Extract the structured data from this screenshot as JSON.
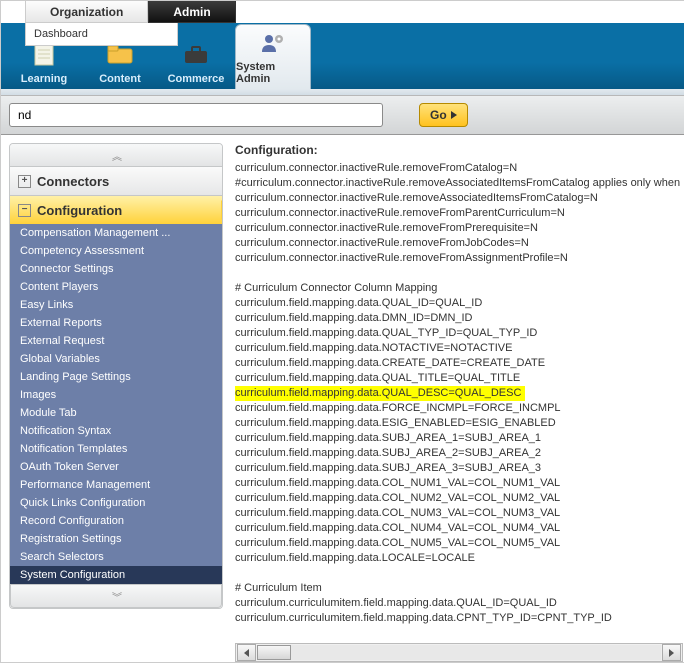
{
  "topmenu": {
    "org": "Organization",
    "admin": "Admin",
    "dropdown": "Dashboard"
  },
  "ribbon": {
    "tabs": [
      {
        "label": "Learning",
        "icon": "page-lines-icon"
      },
      {
        "label": "Content",
        "icon": "folder-icon"
      },
      {
        "label": "Commerce",
        "icon": "briefcase-icon"
      },
      {
        "label": "System Admin",
        "icon": "user-gear-icon"
      }
    ],
    "active_index": 3
  },
  "search": {
    "value": "nd",
    "go": "Go"
  },
  "sidebar": {
    "sections": {
      "connectors": "Connectors",
      "configuration": "Configuration"
    },
    "items": [
      "Compensation Management ...",
      "Competency Assessment",
      "Connector Settings",
      "Content Players",
      "Easy Links",
      "External Reports",
      "External Request",
      "Global Variables",
      "Landing Page Settings",
      "Images",
      "Module Tab",
      "Notification Syntax",
      "Notification Templates",
      "OAuth Token Server",
      "Performance Management",
      "Quick Links Configuration",
      "Record Configuration",
      "Registration Settings",
      "Search Selectors",
      "System Configuration"
    ],
    "active_index": 19
  },
  "content": {
    "title": "Configuration:",
    "lines": [
      "curriculum.connector.inactiveRule.removeFromCatalog=N",
      "#curriculum.connector.inactiveRule.removeAssociatedItemsFromCatalog applies only when",
      "curriculum.connector.inactiveRule.removeAssociatedItemsFromCatalog=N",
      "curriculum.connector.inactiveRule.removeFromParentCurriculum=N",
      "curriculum.connector.inactiveRule.removeFromPrerequisite=N",
      "curriculum.connector.inactiveRule.removeFromJobCodes=N",
      "curriculum.connector.inactiveRule.removeFromAssignmentProfile=N",
      "",
      "# Curriculum Connector Column Mapping",
      "curriculum.field.mapping.data.QUAL_ID=QUAL_ID",
      "curriculum.field.mapping.data.DMN_ID=DMN_ID",
      "curriculum.field.mapping.data.QUAL_TYP_ID=QUAL_TYP_ID",
      "curriculum.field.mapping.data.NOTACTIVE=NOTACTIVE",
      "curriculum.field.mapping.data.CREATE_DATE=CREATE_DATE",
      "curriculum.field.mapping.data.QUAL_TITLE=QUAL_TITLE",
      "curriculum.field.mapping.data.QUAL_DESC=QUAL_DESC",
      "curriculum.field.mapping.data.FORCE_INCMPL=FORCE_INCMPL",
      "curriculum.field.mapping.data.ESIG_ENABLED=ESIG_ENABLED",
      "curriculum.field.mapping.data.SUBJ_AREA_1=SUBJ_AREA_1",
      "curriculum.field.mapping.data.SUBJ_AREA_2=SUBJ_AREA_2",
      "curriculum.field.mapping.data.SUBJ_AREA_3=SUBJ_AREA_3",
      "curriculum.field.mapping.data.COL_NUM1_VAL=COL_NUM1_VAL",
      "curriculum.field.mapping.data.COL_NUM2_VAL=COL_NUM2_VAL",
      "curriculum.field.mapping.data.COL_NUM3_VAL=COL_NUM3_VAL",
      "curriculum.field.mapping.data.COL_NUM4_VAL=COL_NUM4_VAL",
      "curriculum.field.mapping.data.COL_NUM5_VAL=COL_NUM5_VAL",
      "curriculum.field.mapping.data.LOCALE=LOCALE",
      "",
      "# Curriculum Item",
      "curriculum.curriculumitem.field.mapping.data.QUAL_ID=QUAL_ID",
      "curriculum.curriculumitem.field.mapping.data.CPNT_TYP_ID=CPNT_TYP_ID"
    ],
    "highlight_index": 15
  }
}
